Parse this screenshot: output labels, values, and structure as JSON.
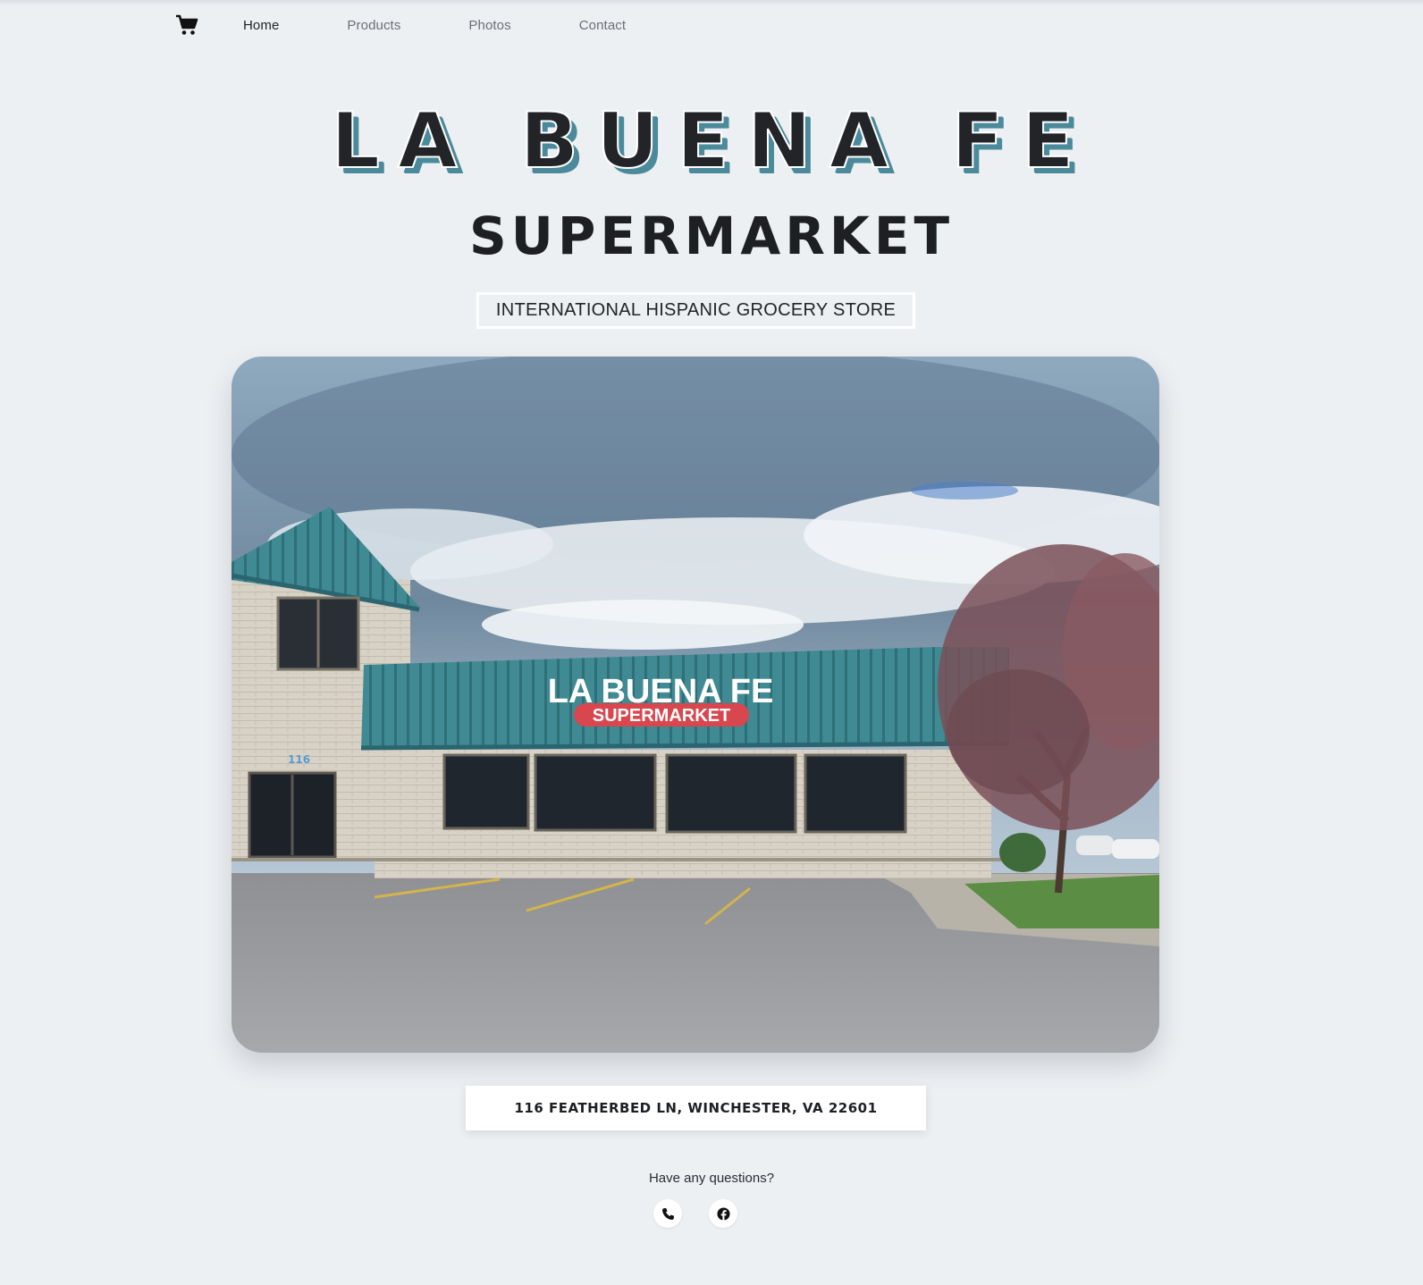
{
  "nav": {
    "cart_icon": "shopping-cart-icon",
    "links": [
      {
        "label": "Home",
        "active": true
      },
      {
        "label": "Products",
        "active": false
      },
      {
        "label": "Photos",
        "active": false
      },
      {
        "label": "Contact",
        "active": false
      }
    ]
  },
  "hero": {
    "title": "LA BUENA FE",
    "subtitle": "SUPERMARKET",
    "tagline": "INTERNATIONAL HISPANIC GROCERY STORE"
  },
  "photo": {
    "sign_line1": "LA BUENA FE",
    "sign_line2": "SUPERMARKET",
    "building_number": "116"
  },
  "address": "116 FEATHERBED LN, WINCHESTER, VA 22601",
  "contact": {
    "prompt": "Have any questions?",
    "icons": [
      "phone-icon",
      "facebook-icon"
    ]
  },
  "colors": {
    "background": "#edf0f3",
    "title_shadow": "#4b8a9a",
    "roof_teal": "#3f8a93",
    "sign_red": "#d8464e"
  }
}
